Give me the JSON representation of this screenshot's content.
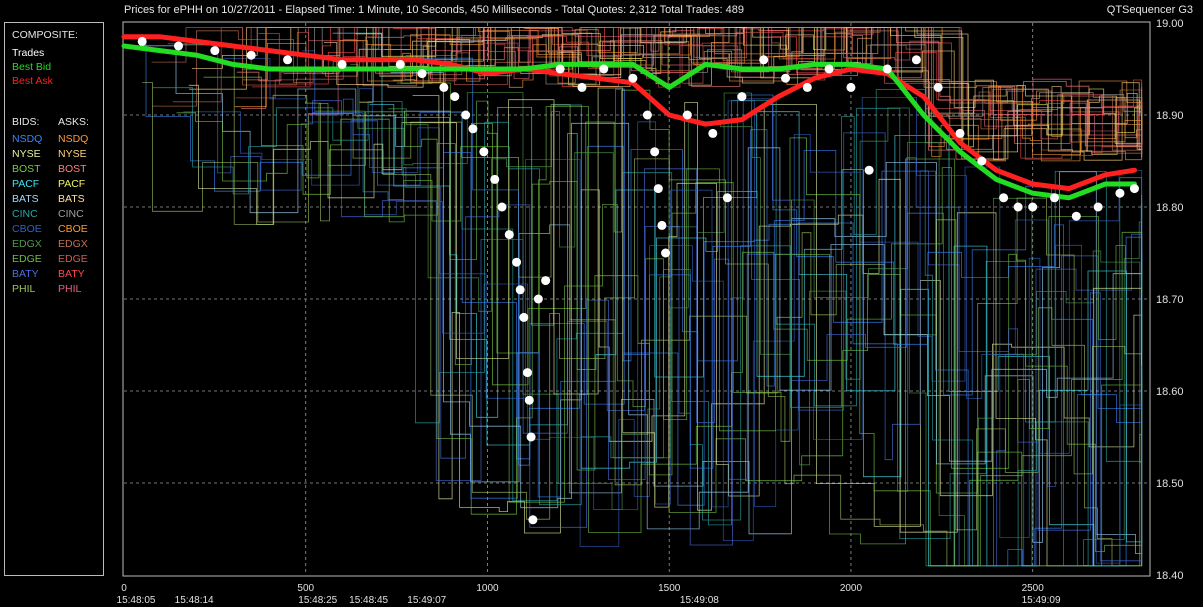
{
  "header": {
    "title": "Prices for  ePHH  on  10/27/2011  -  Elapsed Time: 1 Minute, 10 Seconds, 450 Milliseconds  -  Total Quotes: 2,312  Total Trades: 489",
    "app_name": "QTSequencer G3"
  },
  "legend": {
    "composite_header": "COMPOSITE:",
    "composite_items": [
      {
        "label": "Trades",
        "color": "#ffffff"
      },
      {
        "label": "Best Bid",
        "color": "#22dd22"
      },
      {
        "label": "Best Ask",
        "color": "#ff2020"
      }
    ],
    "bids_header": "BIDS:",
    "asks_header": "ASKS:",
    "exchanges": [
      {
        "bid": "NSDQ",
        "ask": "NSDQ",
        "bid_color": "#3a86ff",
        "ask_color": "#ff9a3c"
      },
      {
        "bid": "NYSE",
        "ask": "NYSE",
        "bid_color": "#e8f0a0",
        "ask_color": "#ffd27a"
      },
      {
        "bid": "BOST",
        "ask": "BOST",
        "bid_color": "#7ac943",
        "ask_color": "#ff7f7f"
      },
      {
        "bid": "PACF",
        "ask": "PACF",
        "bid_color": "#44e0f0",
        "ask_color": "#f0f066"
      },
      {
        "bid": "BATS",
        "ask": "BATS",
        "bid_color": "#a0d8ff",
        "ask_color": "#ffe0a0"
      },
      {
        "bid": "CINC",
        "ask": "CINC",
        "bid_color": "#2aa6a6",
        "ask_color": "#a0a0a0"
      },
      {
        "bid": "CBOE",
        "ask": "CBOE",
        "bid_color": "#3060c0",
        "ask_color": "#ff9933"
      },
      {
        "bid": "EDGX",
        "ask": "EDGX",
        "bid_color": "#4f9a4f",
        "ask_color": "#c07050"
      },
      {
        "bid": "EDGE",
        "ask": "EDGE",
        "bid_color": "#6fbf3f",
        "ask_color": "#d05a5a"
      },
      {
        "bid": "BATY",
        "ask": "BATY",
        "bid_color": "#4a6fe0",
        "ask_color": "#ff4a4a"
      },
      {
        "bid": "PHIL",
        "ask": "PHIL",
        "bid_color": "#a0c060",
        "ask_color": "#e06080"
      }
    ]
  },
  "chart_data": {
    "type": "line",
    "title": "",
    "xlabel": "",
    "ylabel": "",
    "xlim": [
      0,
      2820
    ],
    "ylim": [
      18.4,
      19.0
    ],
    "grid": true,
    "y_ticks": [
      "19.00",
      "18.90",
      "18.80",
      "18.70",
      "18.60",
      "18.50",
      "18.40"
    ],
    "x_ticks": [
      "0",
      "500",
      "1000",
      "1500",
      "2000",
      "2500"
    ],
    "time_labels": [
      {
        "x": 0,
        "label": "15:48:05"
      },
      {
        "x": 160,
        "label": "15:48:14"
      },
      {
        "x": 500,
        "label": "15:48:25"
      },
      {
        "x": 640,
        "label": "15:48:45"
      },
      {
        "x": 800,
        "label": "15:49:07"
      },
      {
        "x": 1550,
        "label": "15:49:08"
      },
      {
        "x": 2490,
        "label": "15:49:09"
      }
    ],
    "series": [
      {
        "name": "Best Ask",
        "color": "#ff2020",
        "values": [
          [
            0,
            18.985
          ],
          [
            100,
            18.985
          ],
          [
            200,
            18.98
          ],
          [
            300,
            18.975
          ],
          [
            400,
            18.97
          ],
          [
            500,
            18.965
          ],
          [
            600,
            18.96
          ],
          [
            700,
            18.96
          ],
          [
            800,
            18.96
          ],
          [
            900,
            18.955
          ],
          [
            1000,
            18.945
          ],
          [
            1100,
            18.95
          ],
          [
            1200,
            18.945
          ],
          [
            1300,
            18.94
          ],
          [
            1400,
            18.935
          ],
          [
            1500,
            18.9
          ],
          [
            1600,
            18.89
          ],
          [
            1700,
            18.895
          ],
          [
            1800,
            18.92
          ],
          [
            1900,
            18.94
          ],
          [
            2000,
            18.95
          ],
          [
            2100,
            18.945
          ],
          [
            2200,
            18.92
          ],
          [
            2300,
            18.87
          ],
          [
            2400,
            18.84
          ],
          [
            2500,
            18.825
          ],
          [
            2600,
            18.82
          ],
          [
            2700,
            18.835
          ],
          [
            2780,
            18.84
          ]
        ]
      },
      {
        "name": "Best Bid",
        "color": "#22dd22",
        "values": [
          [
            0,
            18.975
          ],
          [
            100,
            18.97
          ],
          [
            200,
            18.965
          ],
          [
            300,
            18.955
          ],
          [
            400,
            18.95
          ],
          [
            500,
            18.95
          ],
          [
            600,
            18.95
          ],
          [
            700,
            18.95
          ],
          [
            800,
            18.95
          ],
          [
            900,
            18.95
          ],
          [
            1000,
            18.95
          ],
          [
            1100,
            18.95
          ],
          [
            1200,
            18.955
          ],
          [
            1300,
            18.955
          ],
          [
            1400,
            18.955
          ],
          [
            1500,
            18.93
          ],
          [
            1600,
            18.955
          ],
          [
            1700,
            18.95
          ],
          [
            1800,
            18.95
          ],
          [
            1900,
            18.955
          ],
          [
            2000,
            18.955
          ],
          [
            2100,
            18.95
          ],
          [
            2200,
            18.9
          ],
          [
            2300,
            18.86
          ],
          [
            2400,
            18.83
          ],
          [
            2500,
            18.815
          ],
          [
            2600,
            18.81
          ],
          [
            2700,
            18.825
          ],
          [
            2780,
            18.825
          ]
        ]
      },
      {
        "name": "Trades",
        "color": "#ffffff",
        "values": [
          [
            50,
            18.98
          ],
          [
            150,
            18.975
          ],
          [
            250,
            18.97
          ],
          [
            350,
            18.965
          ],
          [
            450,
            18.96
          ],
          [
            600,
            18.955
          ],
          [
            760,
            18.955
          ],
          [
            820,
            18.945
          ],
          [
            880,
            18.93
          ],
          [
            910,
            18.92
          ],
          [
            940,
            18.9
          ],
          [
            960,
            18.885
          ],
          [
            990,
            18.86
          ],
          [
            1020,
            18.83
          ],
          [
            1040,
            18.8
          ],
          [
            1060,
            18.77
          ],
          [
            1080,
            18.74
          ],
          [
            1090,
            18.71
          ],
          [
            1100,
            18.68
          ],
          [
            1110,
            18.62
          ],
          [
            1115,
            18.59
          ],
          [
            1120,
            18.55
          ],
          [
            1125,
            18.46
          ],
          [
            1140,
            18.7
          ],
          [
            1160,
            18.72
          ],
          [
            1200,
            18.95
          ],
          [
            1260,
            18.93
          ],
          [
            1320,
            18.95
          ],
          [
            1400,
            18.94
          ],
          [
            1440,
            18.9
          ],
          [
            1460,
            18.86
          ],
          [
            1470,
            18.82
          ],
          [
            1480,
            18.78
          ],
          [
            1490,
            18.75
          ],
          [
            1550,
            18.9
          ],
          [
            1620,
            18.88
          ],
          [
            1660,
            18.81
          ],
          [
            1700,
            18.92
          ],
          [
            1760,
            18.96
          ],
          [
            1820,
            18.94
          ],
          [
            1880,
            18.93
          ],
          [
            1940,
            18.95
          ],
          [
            2000,
            18.93
          ],
          [
            2050,
            18.84
          ],
          [
            2100,
            18.95
          ],
          [
            2180,
            18.96
          ],
          [
            2240,
            18.93
          ],
          [
            2300,
            18.88
          ],
          [
            2360,
            18.85
          ],
          [
            2420,
            18.81
          ],
          [
            2460,
            18.8
          ],
          [
            2500,
            18.8
          ],
          [
            2560,
            18.81
          ],
          [
            2620,
            18.79
          ],
          [
            2680,
            18.8
          ],
          [
            2740,
            18.815
          ],
          [
            2780,
            18.82
          ]
        ]
      }
    ]
  }
}
